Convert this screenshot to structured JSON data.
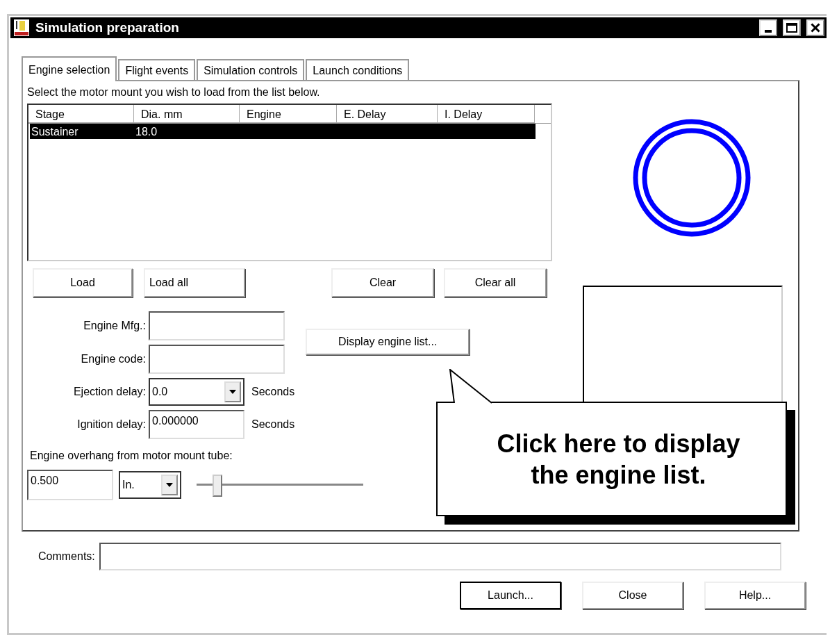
{
  "window": {
    "title": "Simulation preparation"
  },
  "tabs": [
    {
      "label": "Engine selection",
      "selected": true
    },
    {
      "label": "Flight events",
      "selected": false
    },
    {
      "label": "Simulation controls",
      "selected": false
    },
    {
      "label": "Launch conditions",
      "selected": false
    }
  ],
  "instruction": "Select the motor mount you wish to load from the list below.",
  "list": {
    "columns": [
      "Stage",
      "Dia. mm",
      "Engine",
      "E. Delay",
      "I. Delay"
    ],
    "rows": [
      {
        "cells": [
          "Sustainer",
          "18.0"
        ],
        "selected": true
      }
    ]
  },
  "list_buttons": [
    "Load",
    "Load all",
    "Clear",
    "Clear all"
  ],
  "engine_mfg": {
    "label": "Engine Mfg.:"
  },
  "engine_code": {
    "label": "Engine code:"
  },
  "display_button": "Display engine list...",
  "ejection_delay": {
    "label": "Ejection delay:",
    "value": "0.0",
    "unit": "Seconds"
  },
  "ignition_delay": {
    "label": "Ignition delay:",
    "value": "0.000000",
    "unit": "Seconds"
  },
  "overhang": {
    "label": "Engine overhang from motor mount tube:",
    "value": "0.500",
    "unit": "In.",
    "level": 0.1
  },
  "callout": "Click here to display the engine list.",
  "comments": {
    "label": "Comments:"
  },
  "footer_buttons": [
    {
      "label": "Launch...",
      "default": true
    },
    {
      "label": "Close",
      "default": false
    },
    {
      "label": "Help...",
      "default": false
    }
  ]
}
